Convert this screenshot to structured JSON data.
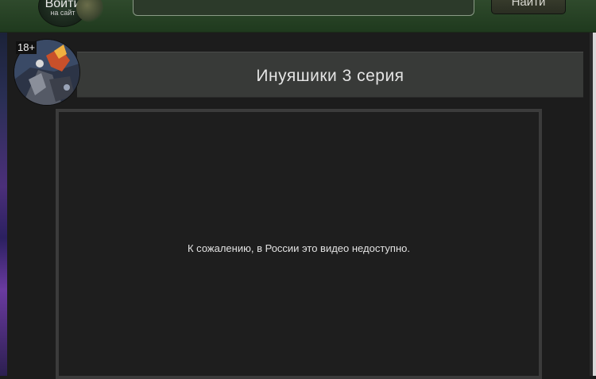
{
  "header": {
    "login_label": "Войти",
    "login_sub": "на сайт",
    "search_placeholder": "",
    "search_button": "Найти"
  },
  "episode": {
    "title": "Инуяшики 3 серия",
    "age_rating": "18+"
  },
  "player": {
    "message": "К сожалению, в России это видео недоступно."
  },
  "colors": {
    "header_green": "#24401f",
    "background": "#1c1c1c",
    "title_bar": "#383a38",
    "player_border": "#3b3b3b"
  }
}
